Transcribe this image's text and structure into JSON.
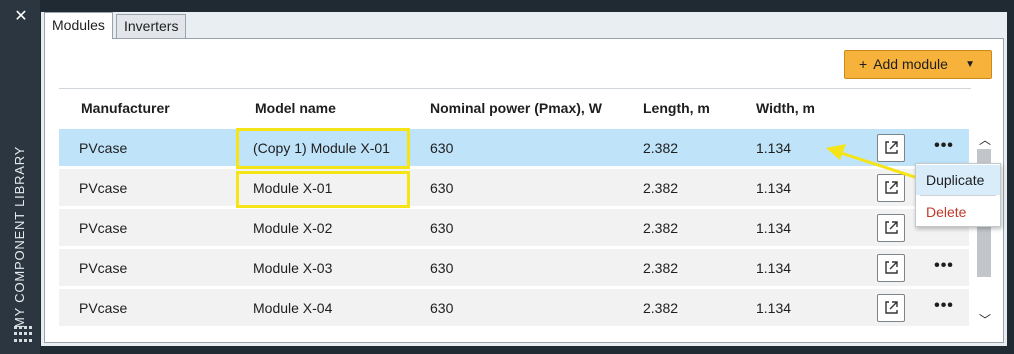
{
  "sidebar": {
    "title": "MY COMPONENT LIBRARY"
  },
  "tabs": [
    {
      "label": "Modules",
      "active": true
    },
    {
      "label": "Inverters",
      "active": false
    }
  ],
  "toolbar": {
    "add_label": "Add module",
    "add_icon": "plus-icon",
    "dropdown_icon": "chevron-down-icon",
    "accent_color": "#f7b23b"
  },
  "table": {
    "columns": [
      "Manufacturer",
      "Model name",
      "Nominal power (Pmax), W",
      "Length, m",
      "Width, m"
    ],
    "rows": [
      {
        "manufacturer": "PVcase",
        "model": "(Copy 1) Module X-01",
        "power": "630",
        "length": "2.382",
        "width": "1.134",
        "selected": true
      },
      {
        "manufacturer": "PVcase",
        "model": "Module X-01",
        "power": "630",
        "length": "2.382",
        "width": "1.134",
        "selected": false
      },
      {
        "manufacturer": "PVcase",
        "model": "Module X-02",
        "power": "630",
        "length": "2.382",
        "width": "1.134",
        "selected": false
      },
      {
        "manufacturer": "PVcase",
        "model": "Module X-03",
        "power": "630",
        "length": "2.382",
        "width": "1.134",
        "selected": false
      },
      {
        "manufacturer": "PVcase",
        "model": "Module X-04",
        "power": "630",
        "length": "2.382",
        "width": "1.134",
        "selected": false
      }
    ],
    "selected_color": "#bfe3f8",
    "row_color": "#f2f2f2"
  },
  "context_menu": {
    "items": [
      "Duplicate",
      "Delete"
    ],
    "delete_color": "#c0392b"
  },
  "annotation": {
    "highlight_color": "#f5e416"
  }
}
